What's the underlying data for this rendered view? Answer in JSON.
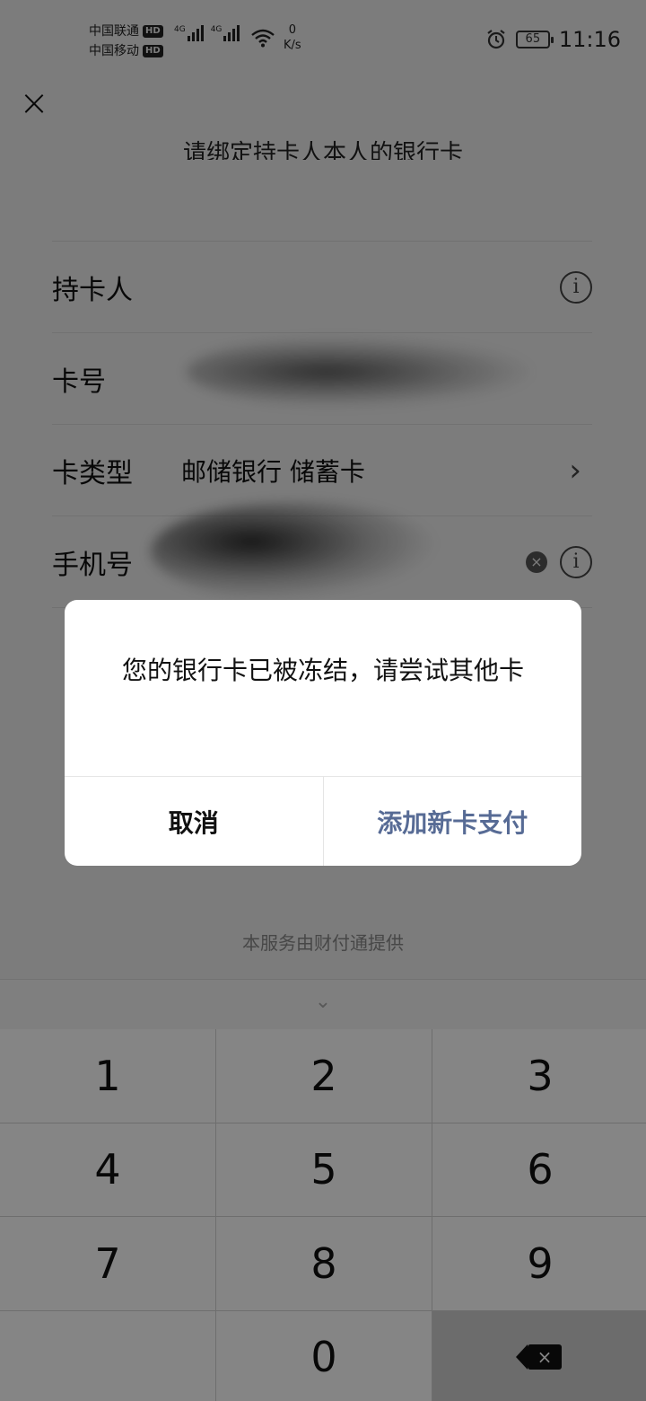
{
  "status_bar": {
    "carrier_1": "中国联通",
    "carrier_2": "中国移动",
    "hd_badge": "HD",
    "network_1": "4G",
    "network_2": "4G",
    "speed_value": "0",
    "speed_unit": "K/s",
    "battery": "65",
    "time": "11:16",
    "icons": [
      "signal-icon",
      "wifi-icon",
      "alarm-icon",
      "battery-icon"
    ]
  },
  "header": {
    "close_icon": "×",
    "title": "请绑定持卡人本人的银行卡"
  },
  "form": {
    "holder_label": "持卡人",
    "card_number_label": "卡号",
    "card_type_label": "卡类型",
    "card_type_value": "邮储银行 储蓄卡",
    "phone_label": "手机号",
    "info_icon": "i",
    "clear_icon": "×",
    "chevron": "›"
  },
  "footer": {
    "provider_text": "本服务由财付通提供",
    "collapse_icon": "⌄"
  },
  "keypad": {
    "keys": [
      "1",
      "2",
      "3",
      "4",
      "5",
      "6",
      "7",
      "8",
      "9",
      "",
      "0"
    ],
    "delete_icon": "×"
  },
  "dialog": {
    "message": "您的银行卡已被冻结，请尝试其他卡",
    "cancel_label": "取消",
    "confirm_label": "添加新卡支付"
  },
  "colors": {
    "link_blue": "#576b95",
    "overlay": "rgba(0,0,0,0.48)",
    "background": "#ededed"
  }
}
